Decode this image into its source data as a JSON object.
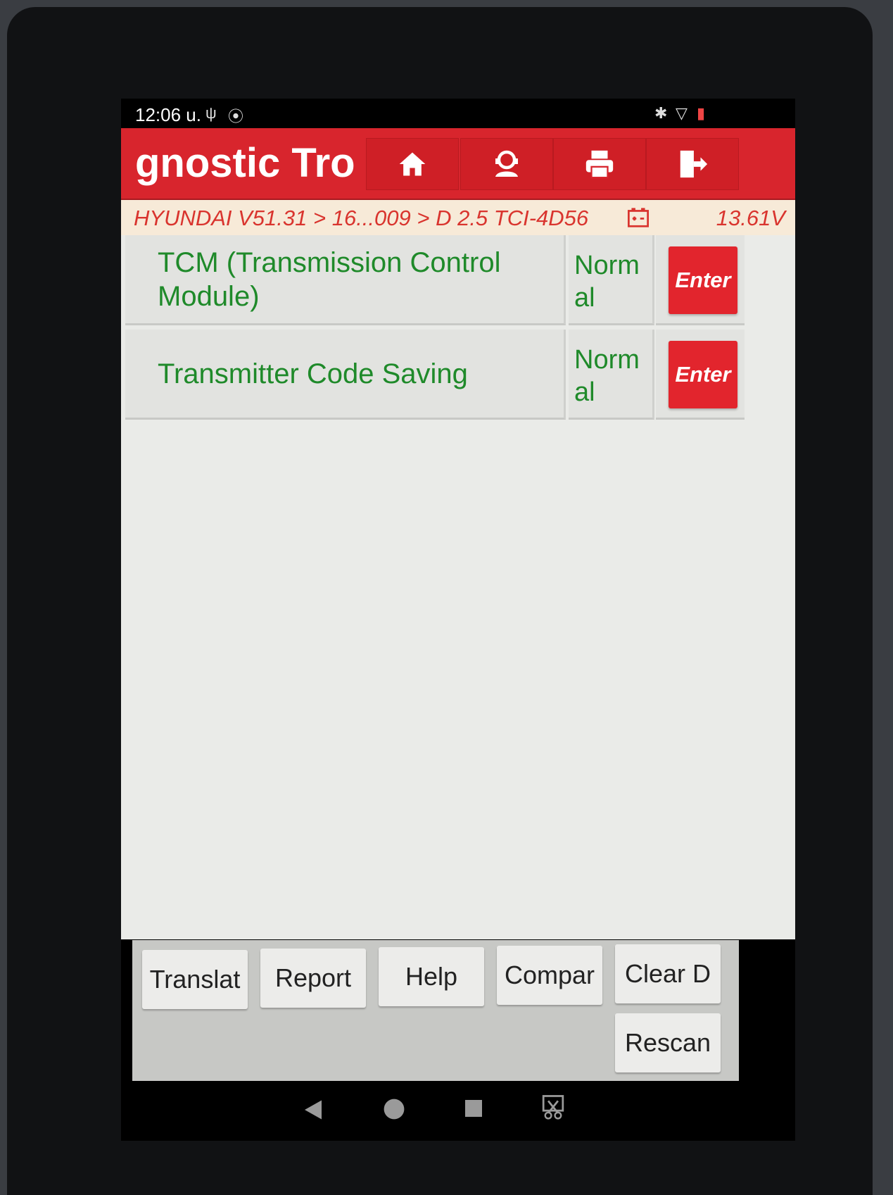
{
  "status_bar": {
    "time": "12:06 u.",
    "icons": [
      "usb-icon",
      "sync-icon",
      "bluetooth-icon",
      "wifi-icon",
      "battery-icon"
    ]
  },
  "title_bar": {
    "title": "gnostic Tro",
    "buttons": [
      "home-icon",
      "support-icon",
      "print-icon",
      "exit-icon"
    ]
  },
  "breadcrumb": {
    "path": "HYUNDAI V51.31 > 16...009 > D 2.5 TCI-4D56",
    "voltage": "13.61V"
  },
  "modules": [
    {
      "name": "TCM (Transmission Control Module)",
      "status": "Normal",
      "action": "Enter"
    },
    {
      "name": "Transmitter Code Saving",
      "status": "Normal",
      "action": "Enter"
    }
  ],
  "toolbar": {
    "translate": "Translat",
    "report": "Report",
    "help": "Help",
    "compare": "Compar",
    "clear": "Clear D",
    "rescan": "Rescan"
  },
  "colors": {
    "header_red": "#d8252d",
    "text_green": "#1f8a2a",
    "crumb_bg": "#f7ead8"
  }
}
